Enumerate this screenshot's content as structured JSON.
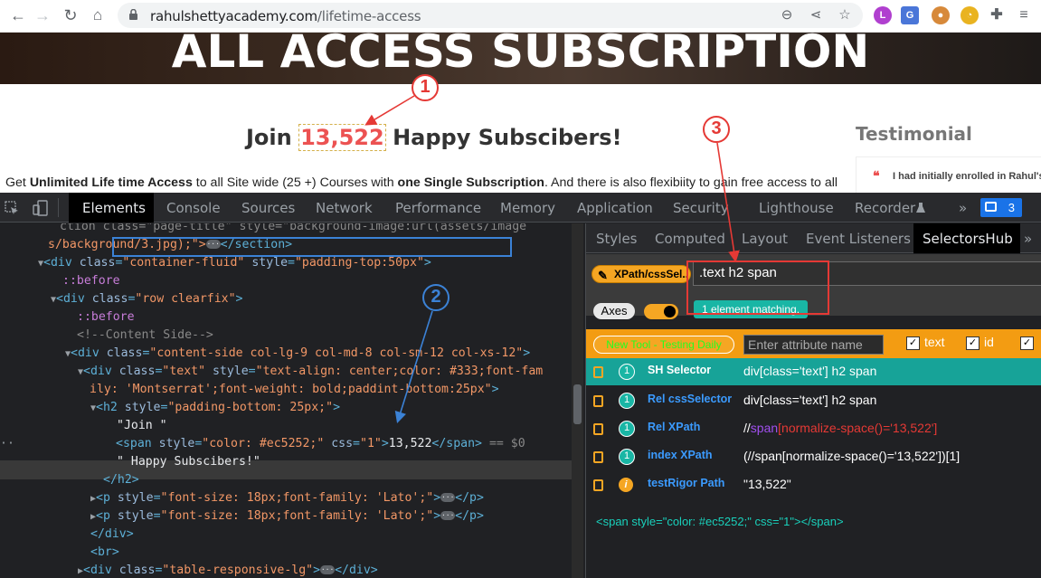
{
  "browser": {
    "url_host": "rahulshettyacademy.com",
    "url_path": "/lifetime-access"
  },
  "page": {
    "banner_title": "ALL ACCESS SUBSCRIPTION",
    "join_prefix": "Join ",
    "join_number": "13,522",
    "join_suffix": " Happy Subscibers!",
    "testimonial_title": "Testimonial",
    "testimonial_quote_mark": "❝",
    "testimonial_snippet": "I had initially enrolled in Rahul's",
    "intro": {
      "get": "Get ",
      "unlimited": "Unlimited Life time Access",
      "to_all": " to all Site wide (25 +) Courses with ",
      "one_single": "one Single Subscription",
      "rest": ". And there is also flexibiity to gain free access to all"
    }
  },
  "devtools": {
    "tabs": [
      "Elements",
      "Console",
      "Sources",
      "Network",
      "Performance",
      "Memory",
      "Application",
      "Security",
      "Lighthouse",
      "Recorder"
    ],
    "more": "»",
    "message_count": "3",
    "code": {
      "l0": "ction class=\"page-title\" style=\"background-image:url(assets/image",
      "l1a": "s/background/3.jpg);\">",
      "l1b": "</section>",
      "l2_tag": "<div ",
      "l2_attr": "class",
      "l2_val": "\"container-fluid\"",
      "l2_attr2": "style",
      "l2_val2": "\"padding-top:50px\"",
      "before": "::before",
      "l4_val": "\"row clearfix\"",
      "comment": "<!--Content Side-->",
      "l7_val": "\"content-side col-lg-9 col-md-8 col-sm-12 col-xs-12\"",
      "l8_val": "\"text\"",
      "l8_val2": "\"text-align: center;color: #333;font-fam",
      "l9_val2": "ily: 'Montserrat';font-weight: bold;paddint-bottom:25px\"",
      "h2_val": "\"padding-bottom: 25px;\"",
      "join_text": "\"Join \"",
      "span_val": "\"color: #ec5252;\"",
      "span_css": "\"1\"",
      "span_text": "13,522",
      "eq0": " == $0",
      "happy_text": "\" Happy Subscibers!\"",
      "h2_close": "</h2>",
      "p_val": "\"font-size: 18px;font-family: 'Lato';\"",
      "p_close": "</p>",
      "div_close": "</div>",
      "br": "<br>",
      "tr_val": "\"table-responsive-lg\""
    },
    "side_tabs": [
      "Styles",
      "Computed",
      "Layout",
      "Event Listeners",
      "SelectorsHub"
    ],
    "side_more": "»"
  },
  "selectorshub": {
    "mode_label": "XPath/cssSel..",
    "selector_value": ".text h2 span",
    "axes_label": "Axes",
    "match_text": "1 element matching.",
    "new_tool": "New Tool - Testing Daily",
    "attr_placeholder": "Enter attribute name",
    "checkboxes": [
      "text",
      "id"
    ],
    "rows": [
      {
        "label": "SH Selector",
        "value": "div[class='text'] h2 span",
        "count": "1"
      },
      {
        "label": "Rel cssSelector",
        "value": "div[class='text'] h2 span",
        "count": "1"
      },
      {
        "label": "Rel XPath",
        "value_a": "//",
        "value_b": "span",
        "value_c": "[normalize-space()='13,522']",
        "count": "1"
      },
      {
        "label": "index XPath",
        "value": "(//span[normalize-space()='13,522'])[1]",
        "count": "1"
      },
      {
        "label": "testRigor Path",
        "value": "\"13,522\"",
        "count": "i"
      }
    ],
    "preview": "<span style=\"color: #ec5252;\" css=\"1\"></span>"
  },
  "annotations": [
    "1",
    "2",
    "3"
  ],
  "colors": {
    "accent_red": "#ec5252",
    "teal": "#17a398",
    "orange": "#f39c12",
    "blue_marker": "#3b82d6"
  }
}
